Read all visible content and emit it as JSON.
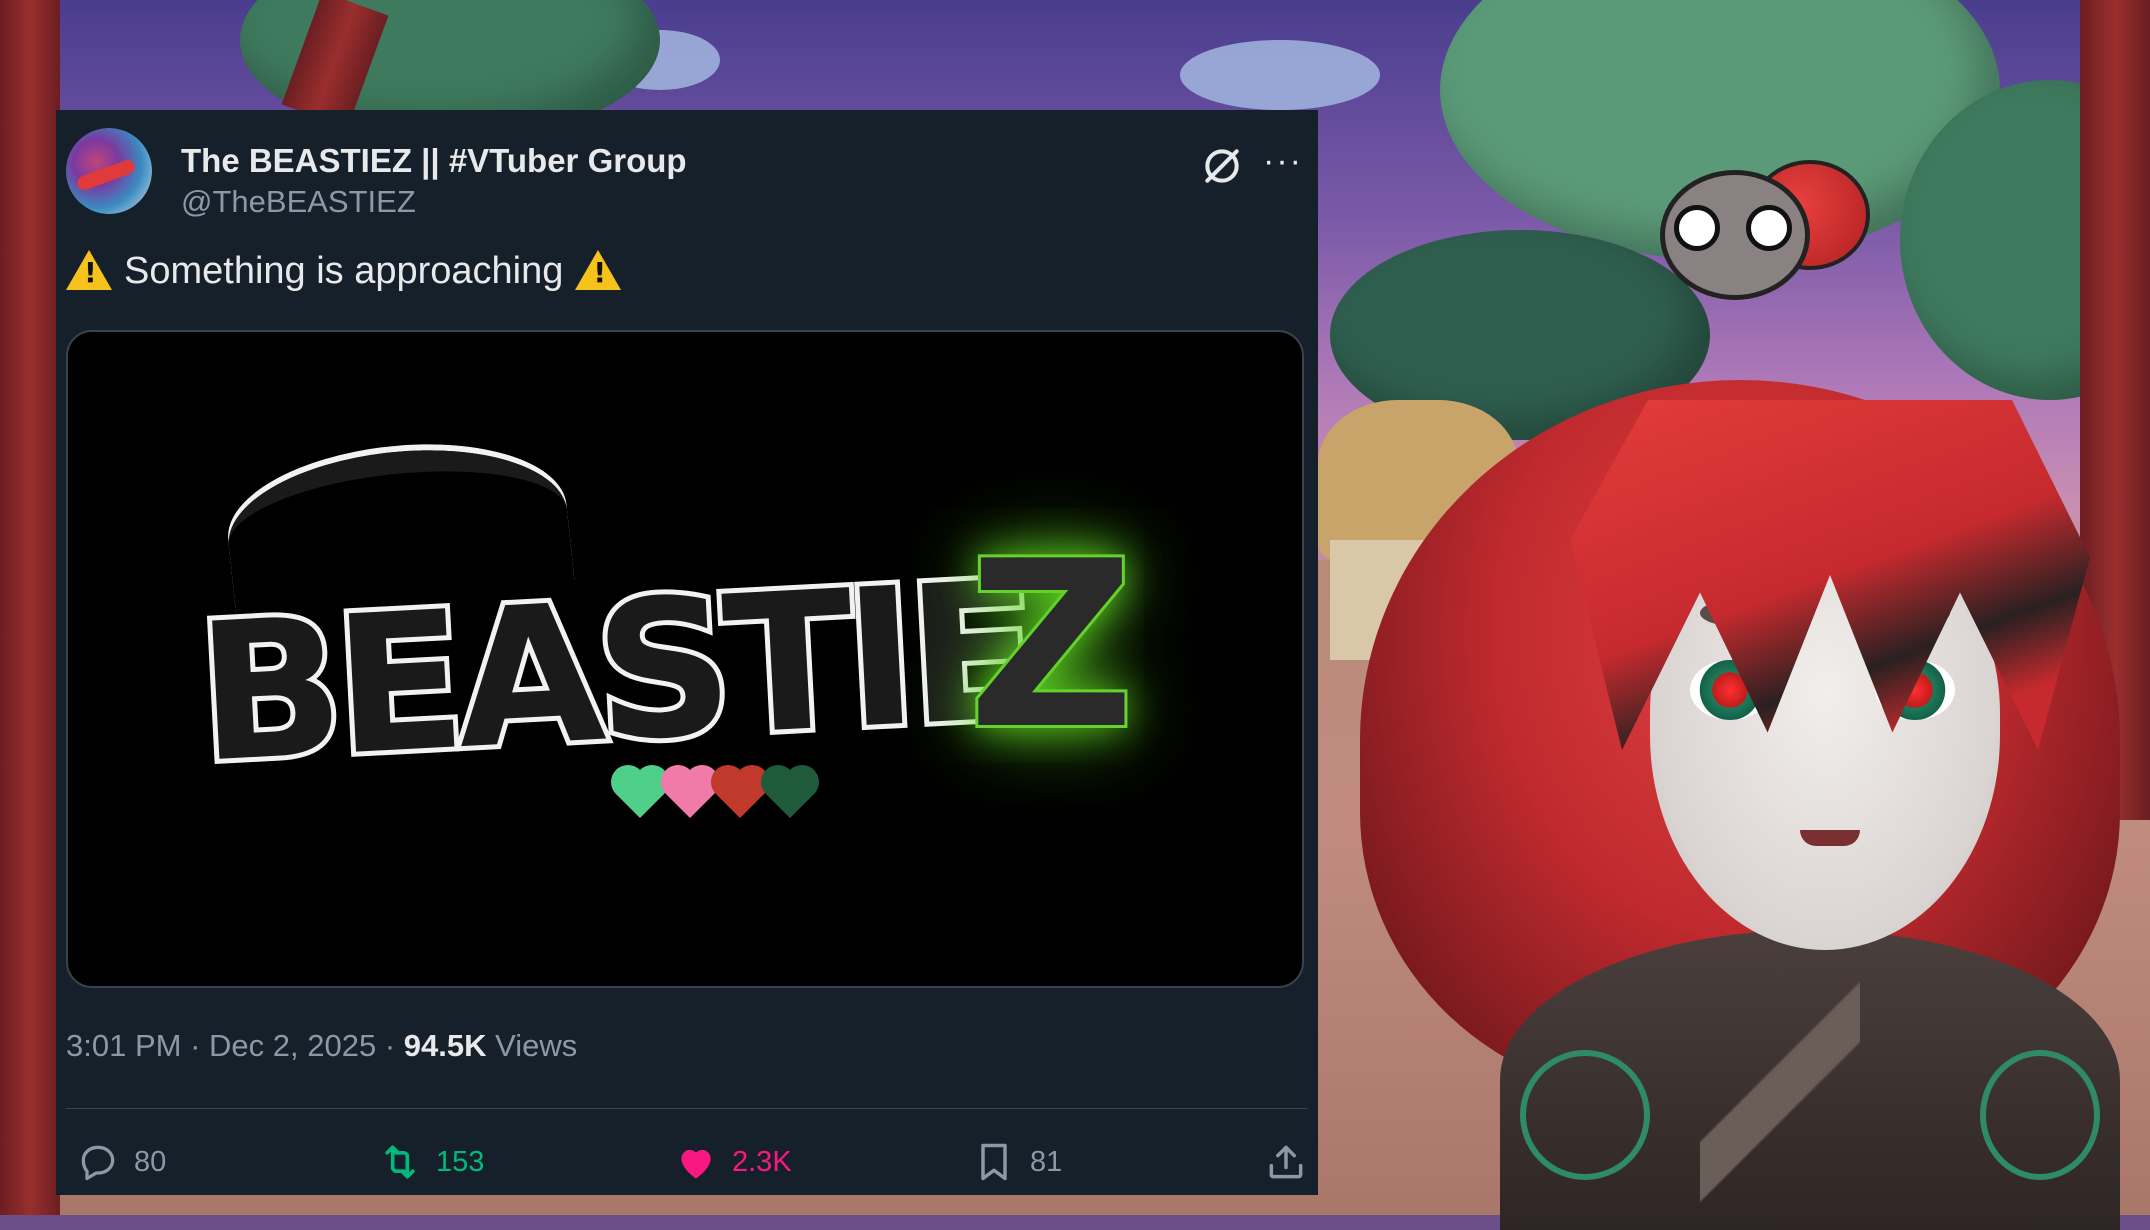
{
  "tweet": {
    "display_name": "The BEASTIEZ || #VTuber Group",
    "handle": "@TheBEASTIEZ",
    "text": "Something is approaching",
    "media_logo_text": "BEASTIE",
    "media_logo_z": "Z",
    "time": "3:01 PM",
    "date": "Dec 2, 2025",
    "views_count": "94.5K",
    "views_label": "Views",
    "separator": "·",
    "more_label": "···"
  },
  "actions": {
    "reply_count": "80",
    "retweet_count": "153",
    "like_count": "2.3K",
    "bookmark_count": "81"
  },
  "colors": {
    "card_bg": "#15202b",
    "retweet": "#00ba7c",
    "like": "#f91880",
    "muted": "#8b98a5",
    "warning": "#f6c21c",
    "logo_glow": "#5fd424"
  },
  "icons": {
    "warning": "warning-icon",
    "grok": "grok-icon",
    "more": "more-icon",
    "reply": "reply-icon",
    "retweet": "retweet-icon",
    "like": "heart-icon",
    "bookmark": "bookmark-icon",
    "share": "share-icon"
  }
}
